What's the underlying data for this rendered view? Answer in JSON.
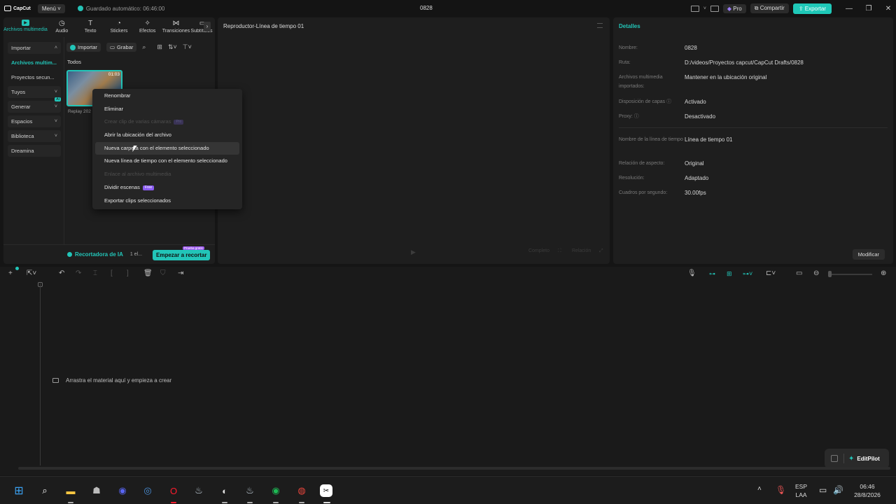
{
  "titlebar": {
    "app_name": "CapCut",
    "menu": "Menú",
    "autosave": "Guardado automático: 06:46:00",
    "project": "0828",
    "pro": "Pro",
    "share": "Compartir",
    "export": "Exportar"
  },
  "media": {
    "tabs": [
      {
        "label": "Archivos multimedia",
        "icon": "media-icon"
      },
      {
        "label": "Audio",
        "icon": "audio-icon"
      },
      {
        "label": "Texto",
        "icon": "text-icon"
      },
      {
        "label": "Stickers",
        "icon": "sticker-icon"
      },
      {
        "label": "Efectos",
        "icon": "effects-icon"
      },
      {
        "label": "Transiciones",
        "icon": "transitions-icon"
      },
      {
        "label": "Subtítulos",
        "icon": "subtitles-icon"
      }
    ],
    "side_nav": [
      {
        "label": "Importar"
      },
      {
        "label": "Archivos multim..."
      },
      {
        "label": "Proyectos secun..."
      },
      {
        "label": "Tuyos"
      },
      {
        "label": "Generar"
      },
      {
        "label": "Espacios"
      },
      {
        "label": "Biblioteca"
      },
      {
        "label": "Dreamina"
      }
    ],
    "ai_badge": "AI",
    "import_btn": "Importar",
    "record_btn": "Grabar",
    "filter_all": "Todos",
    "clip": {
      "name": "Replay 202",
      "duration": "01:03"
    },
    "footer": {
      "ia_label": "Recortadora de IA",
      "count": "1 el...",
      "start_btn": "Empezar a recortar",
      "badge": "Prueba gratis"
    }
  },
  "context_menu": {
    "items": [
      {
        "label": "Renombrar",
        "disabled": false
      },
      {
        "label": "Eliminar",
        "disabled": false
      },
      {
        "label": "Crear clip de varias cámaras",
        "disabled": true,
        "badge": "Pro"
      },
      {
        "label": "Abrir la ubicación del archivo",
        "disabled": false
      },
      {
        "label": "Nueva carpeta con el elemento seleccionado",
        "disabled": false
      },
      {
        "label": "Nueva línea de tiempo con el elemento seleccionado",
        "disabled": false
      },
      {
        "label": "Enlace al archivo multimedia",
        "disabled": true
      },
      {
        "label": "Dividir escenas",
        "disabled": false,
        "badge": "Free"
      },
      {
        "label": "Exportar clips seleccionados",
        "disabled": false
      }
    ]
  },
  "player": {
    "title": "Reproductor-Línea de tiempo 01",
    "full": "Completo",
    "ratio": "Relación"
  },
  "details": {
    "title": "Detalles",
    "rows": [
      {
        "key": "Nombre:",
        "value": "0828"
      },
      {
        "key": "Ruta:",
        "value": "D:/videos/Proyectos capcut/CapCut Drafts/0828"
      },
      {
        "key": "Archivos multimedia importados:",
        "value": "Mantener en la ubicación original"
      },
      {
        "key": "Disposición de capas",
        "value": "Activado"
      },
      {
        "key": "Proxy:",
        "value": "Desactivado"
      },
      {
        "key": "Nombre de la línea de tiempo",
        "value": "Línea de tiempo 01"
      },
      {
        "key": "Relación de aspecto:",
        "value": "Original"
      },
      {
        "key": "Resolución:",
        "value": "Adaptado"
      },
      {
        "key": "Cuadros por segundo:",
        "value": "30.00fps"
      }
    ],
    "modify": "Modificar"
  },
  "timeline": {
    "drop_hint": "Arrastra el material aquí y empieza a crear",
    "editpilot": "EditPilot"
  },
  "taskbar": {
    "lang": "ESP",
    "layout": "LAA",
    "time": "06:46",
    "date": "28/8/2026"
  },
  "colors": {
    "accent": "#22c5b8",
    "background": "#151515",
    "panel": "#1e1e1e",
    "menu": "#252525",
    "pro_badge": "#8a5cf0"
  }
}
